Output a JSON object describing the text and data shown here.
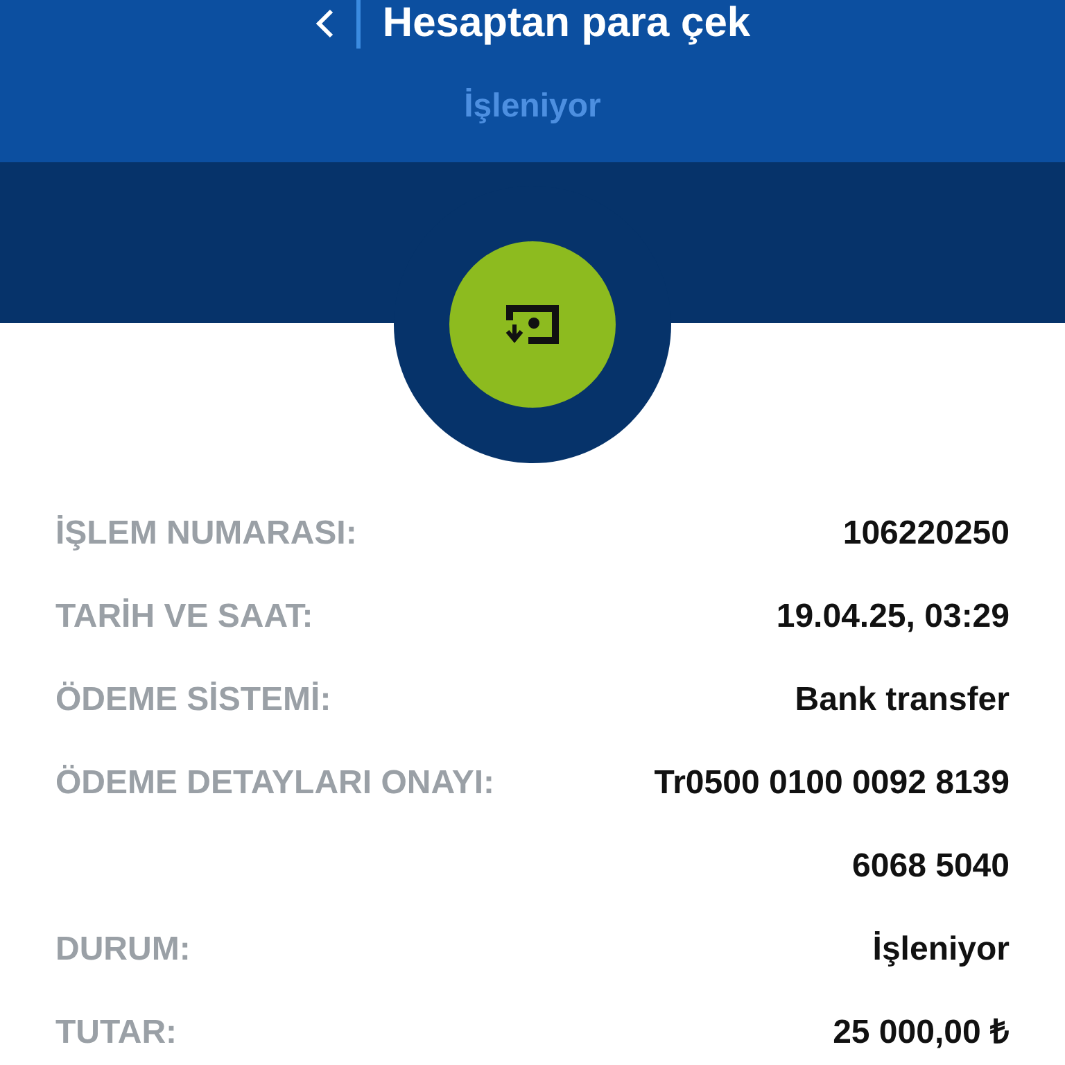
{
  "header": {
    "title": "Hesaptan para çek",
    "subtitle": "İşleniyor"
  },
  "details": [
    {
      "label": "İŞLEM NUMARASI:",
      "value": "106220250"
    },
    {
      "label": "TARİH VE SAAT:",
      "value": "19.04.25, 03:29"
    },
    {
      "label": "ÖDEME SİSTEMİ:",
      "value": "Bank transfer"
    },
    {
      "label": "ÖDEME DETAYLARI ONAYI:",
      "value": "Tr0500 0100 0092 8139 6068 5040"
    },
    {
      "label": "DURUM:",
      "value": "İşleniyor"
    },
    {
      "label": "TUTAR:",
      "value": "25 000,00 ₺"
    }
  ]
}
